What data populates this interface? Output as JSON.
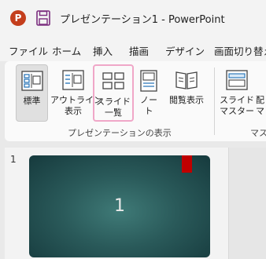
{
  "window": {
    "title": "プレゼンテーション1  -  PowerPoint",
    "app_icon_letter": "P"
  },
  "menu": {
    "tabs": [
      "ファイル",
      "ホーム",
      "挿入",
      "描画",
      "デザイン",
      "画面切り替え"
    ]
  },
  "ribbon": {
    "buttons": {
      "normal": "標準",
      "outline": "アウトライン\n表示",
      "sorter": "スライド\n一覧",
      "notes": "ノー\nト",
      "reading": "閲覧表示",
      "master": "スライド\nマスター",
      "handout": "配\nマ"
    },
    "groups": {
      "presentation_views": "プレゼンテーションの表示",
      "master_views": "マス"
    }
  },
  "slides": [
    {
      "number": "1",
      "title": "1"
    }
  ],
  "colors": {
    "accent_red": "#c00000",
    "highlight_pink": "#f0a7c8",
    "slide_teal": "#2a5a5a",
    "app_orange": "#c43e1c"
  }
}
